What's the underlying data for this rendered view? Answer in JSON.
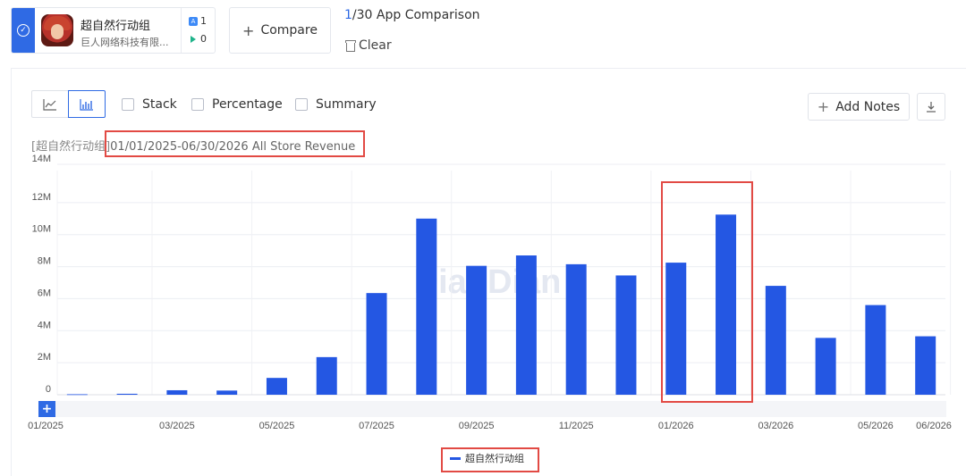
{
  "app": {
    "name": "超自然行动组",
    "developer": "巨人网络科技有限...",
    "ios_count": "1",
    "gp_count": "0",
    "icons": {
      "selected": "check-circle-icon",
      "ios": "app-store-icon",
      "gp": "google-play-icon"
    }
  },
  "toolbar": {
    "compare_label": "Compare",
    "count_current": "1",
    "count_rest": "/30 App Comparison",
    "clear_label": "Clear"
  },
  "chart_controls": {
    "stack_label": "Stack",
    "percentage_label": "Percentage",
    "summary_label": "Summary",
    "add_notes_label": "Add Notes"
  },
  "chart_title": {
    "prefix": "[超自然行动组]",
    "range": "01/01/2025-06/30/2026 All Store Revenue"
  },
  "watermark": "DianDian",
  "colors": {
    "accent": "#2f6ae4",
    "bar": "#2457e3",
    "highlight": "#e24a44"
  },
  "chart_data": {
    "type": "bar",
    "categories": [
      "01/2025",
      "02/2025",
      "03/2025",
      "04/2025",
      "05/2025",
      "06/2025",
      "07/2025",
      "08/2025",
      "09/2025",
      "10/2025",
      "11/2025",
      "12/2025",
      "01/2026",
      "02/2026",
      "03/2026",
      "04/2026",
      "05/2026",
      "06/2026"
    ],
    "x_tick_labels": [
      "01/2025",
      "03/2025",
      "05/2025",
      "07/2025",
      "09/2025",
      "11/2025",
      "01/2026",
      "03/2026",
      "05/2026",
      "06/2026"
    ],
    "series": [
      {
        "name": "超自然行动组",
        "values": [
          30000,
          60000,
          280000,
          260000,
          1050000,
          2350000,
          6350000,
          11000000,
          8050000,
          8700000,
          8150000,
          7450000,
          8250000,
          11250000,
          6800000,
          3550000,
          5600000,
          3650000
        ]
      }
    ],
    "y_tick_labels": [
      "0",
      "2M",
      "4M",
      "6M",
      "8M",
      "10M",
      "12M",
      "14M"
    ],
    "ylim": [
      0,
      14000000
    ],
    "grid": true,
    "legend": "bottom-center"
  }
}
